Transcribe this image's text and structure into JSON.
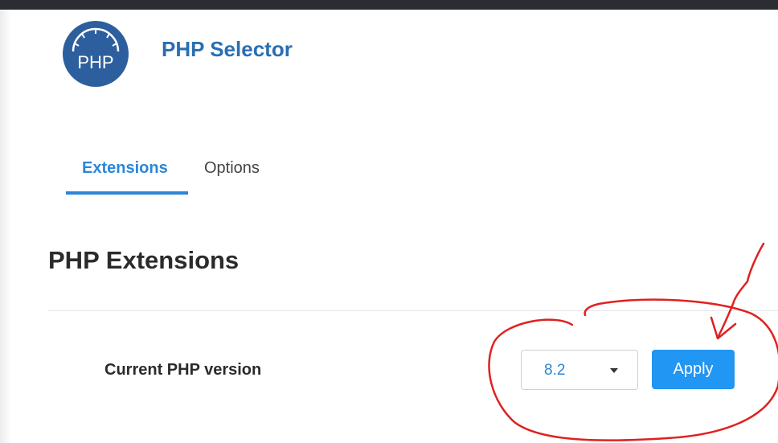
{
  "app": {
    "title": "PHP Selector",
    "logo_text": "PHP",
    "logo_color": "#2d5f9e",
    "accent": "#2a86d8"
  },
  "tabs": [
    {
      "label": "Extensions",
      "active": true
    },
    {
      "label": "Options",
      "active": false
    }
  ],
  "main": {
    "section_title": "PHP Extensions",
    "version_label": "Current PHP version",
    "version_selected": "8.2",
    "apply_label": "Apply"
  },
  "annotation": {
    "color": "#e02020"
  }
}
